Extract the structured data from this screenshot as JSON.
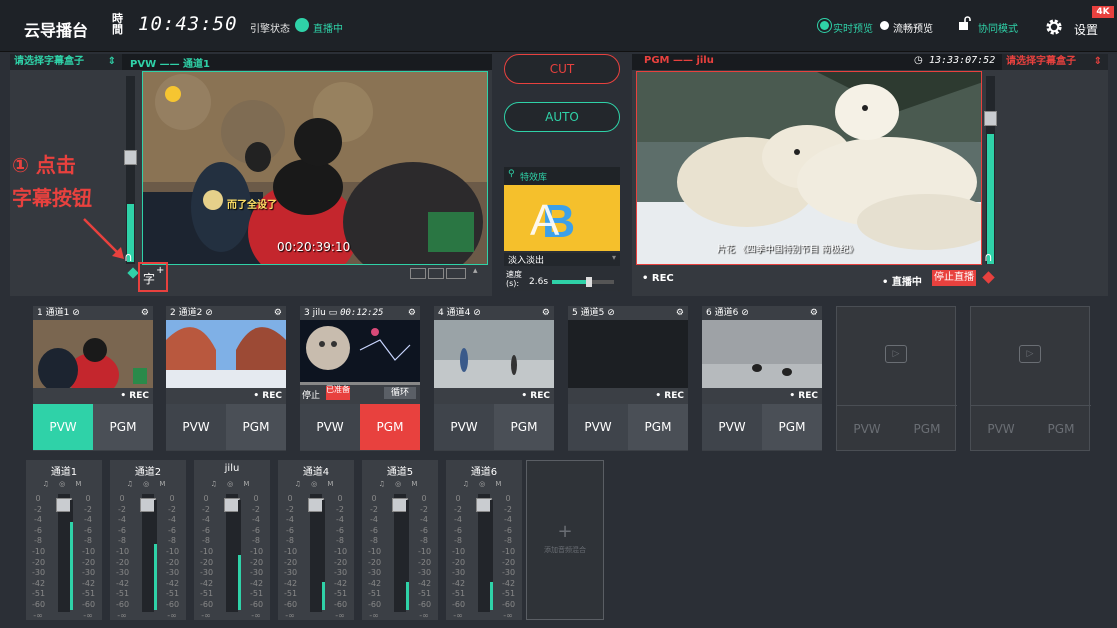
{
  "topbar": {
    "title": "云导播台",
    "clock_icon": "clock-icon",
    "clock_glyph": "時間",
    "time": "10:43:50",
    "engine_label": "引擎状态",
    "engine_status": "直播中",
    "preview_realtime": "实时预览",
    "preview_smooth": "流畅预览",
    "collab_mode": "协同模式",
    "settings": "设置",
    "badge": "4K"
  },
  "pvw": {
    "subtitle_select": "请选择字幕盒子",
    "title": "PVW —— 通道1",
    "overlay_text": "而了全设了",
    "overlay_time": "00:20:39:10",
    "caption_btn": "字",
    "annotation_line1": "① 点击",
    "annotation_line2": "字幕按钮"
  },
  "center": {
    "cut": "CUT",
    "auto": "AUTO",
    "effects_title": "特效库",
    "transition": "淡入淡出",
    "speed_label_1": "速度",
    "speed_label_2": "(s):",
    "speed_value": "2.6s",
    "speed_level": 0.6
  },
  "pgm": {
    "title": "PGM —— jilu",
    "time": "13:33:07:52",
    "subtitle_select": "请选择字幕盒子",
    "caption_text": "片花 《四季中国特别节目 南极纪》",
    "rec": "• REC",
    "live_label": "• 直播中",
    "stop_live": "停止直播"
  },
  "channels": [
    {
      "label": "1 通道1",
      "rec": "• REC",
      "pvw": "PVW",
      "pgm": "PGM"
    },
    {
      "label": "2 通道2",
      "rec": "• REC",
      "pvw": "PVW",
      "pgm": "PGM"
    },
    {
      "label": "3 jilu",
      "time": "00:12:25",
      "rec": "",
      "stop": "停止",
      "prep": "已准备",
      "loop": "循环",
      "pvw": "PVW",
      "pgm": "PGM"
    },
    {
      "label": "4 通道4",
      "rec": "• REC",
      "pvw": "PVW",
      "pgm": "PGM"
    },
    {
      "label": "5 通道5",
      "rec": "• REC",
      "pvw": "PVW",
      "pgm": "PGM"
    },
    {
      "label": "6 通道6",
      "rec": "• REC",
      "pvw": "PVW",
      "pgm": "PGM"
    }
  ],
  "empty_channels": [
    {
      "pvw": "PVW",
      "pgm": "PGM"
    },
    {
      "pvw": "PVW",
      "pgm": "PGM"
    }
  ],
  "audio": {
    "channels": [
      "通道1",
      "通道2",
      "jilu",
      "通道4",
      "通道5",
      "通道6"
    ],
    "icons": "♫ ◎ M",
    "scale": [
      "0",
      "-2",
      "-4",
      "-6",
      "-8",
      "-10",
      "-20",
      "-30",
      "-42",
      "-51",
      "-60",
      "-∞"
    ],
    "add_label": "添加音频混合"
  },
  "colors": {
    "accent": "#2fd2a8",
    "red": "#e8413e",
    "bg": "#2b2f36"
  }
}
